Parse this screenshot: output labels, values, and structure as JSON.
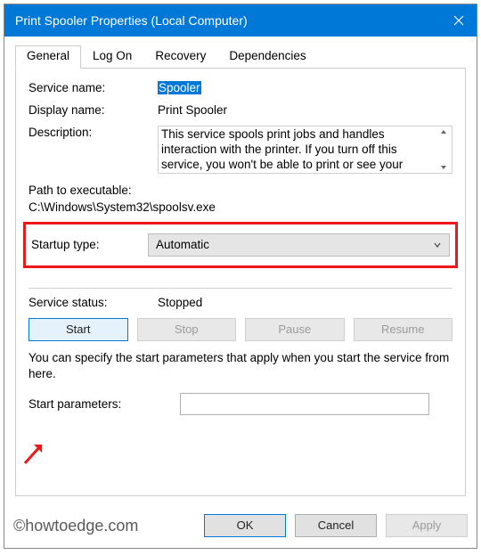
{
  "window": {
    "title": "Print Spooler Properties (Local Computer)"
  },
  "tabs": {
    "general": "General",
    "logon": "Log On",
    "recovery": "Recovery",
    "dependencies": "Dependencies"
  },
  "labels": {
    "service_name": "Service name:",
    "display_name": "Display name:",
    "description": "Description:",
    "path": "Path to executable:",
    "startup_type": "Startup type:",
    "service_status": "Service status:",
    "start_parameters": "Start parameters:"
  },
  "values": {
    "service_name": "Spooler",
    "display_name": "Print Spooler",
    "description": "This service spools print jobs and handles interaction with the printer.  If you turn off this service, you won't be able to print or see your printers.",
    "path": "C:\\Windows\\System32\\spoolsv.exe",
    "startup_type": "Automatic",
    "service_status": "Stopped",
    "start_parameters": ""
  },
  "buttons": {
    "start": "Start",
    "stop": "Stop",
    "pause": "Pause",
    "resume": "Resume",
    "ok": "OK",
    "cancel": "Cancel",
    "apply": "Apply"
  },
  "hint": "You can specify the start parameters that apply when you start the service from here.",
  "watermark": "©howtoedge.com"
}
